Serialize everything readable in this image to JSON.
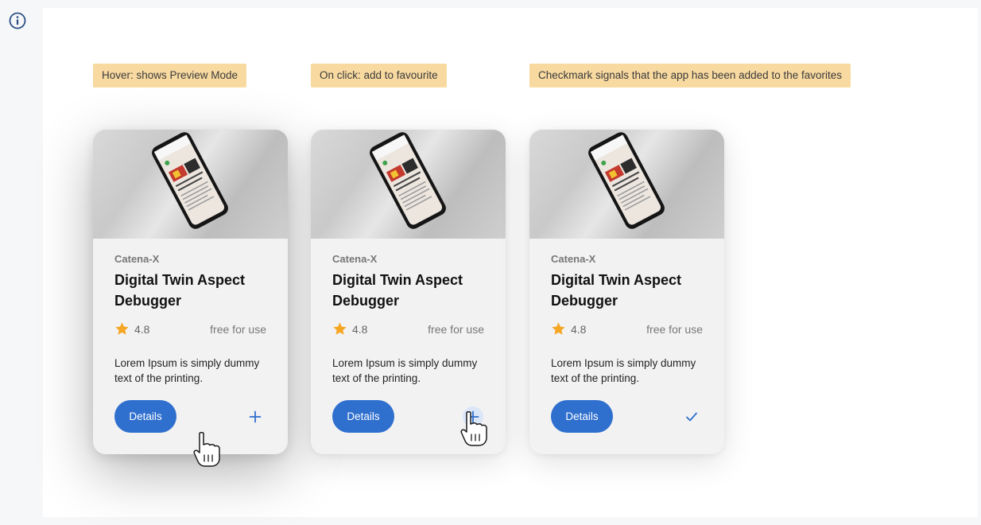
{
  "annotations": [
    "Hover: shows Preview Mode",
    "On click: add to favourite",
    "Checkmark signals that the app has been added to the favorites"
  ],
  "cards": [
    {
      "provider": "Catena-X",
      "title": "Digital Twin Aspect Debugger",
      "rating": "4.8",
      "price": "free for use",
      "description": "Lorem Ipsum is simply dummy text of the printing.",
      "details_label": "Details",
      "favorite_state": "add"
    },
    {
      "provider": "Catena-X",
      "title": "Digital Twin Aspect Debugger",
      "rating": "4.8",
      "price": "free for use",
      "description": "Lorem Ipsum is simply dummy text of the printing.",
      "details_label": "Details",
      "favorite_state": "add-pressed"
    },
    {
      "provider": "Catena-X",
      "title": "Digital Twin Aspect Debugger",
      "rating": "4.8",
      "price": "free for use",
      "description": "Lorem Ipsum is simply dummy text of the printing.",
      "details_label": "Details",
      "favorite_state": "added"
    }
  ],
  "colors": {
    "accent": "#2f6fce",
    "note_background": "#f8d9a0",
    "star": "#f5a623",
    "info_icon": "#2c4f85"
  },
  "icons": {
    "info": "info-circle-icon",
    "star": "star-icon",
    "add": "plus-icon",
    "added": "checkmark-icon",
    "cursor": "hand-pointer-icon"
  }
}
